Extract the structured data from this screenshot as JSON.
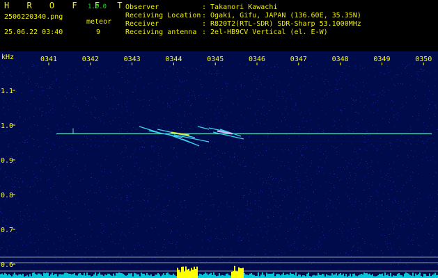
{
  "header": {
    "app_title": "H R O F F T",
    "app_version": "1.0.0",
    "filename": "2506220340.png",
    "datetime": "25.06.22 03:40",
    "meteor_label": "meteor",
    "meteor_count": "9"
  },
  "info": [
    {
      "label": "Observer",
      "value": ": Takanori Kawachi"
    },
    {
      "label": "Receiving Location",
      "value": ": Ogaki, Gifu, JAPAN (136.60E, 35.35N)"
    },
    {
      "label": "Receiver",
      "value": ": R820T2(RTL-SDR) SDR-Sharp 53.1000MHz"
    },
    {
      "label": "Receiving antenna",
      "value": ": 2el-HB9CV Vertical (el. E-W)"
    }
  ],
  "spectrogram": {
    "unit_label": "kHz",
    "time_labels": [
      "0341",
      "0342",
      "0343",
      "0344",
      "0345",
      "0346",
      "0347",
      "0348",
      "0349",
      "0350"
    ],
    "freq_labels": [
      "1.1",
      "1.0",
      "0.9",
      "0.8",
      "0.7",
      "0.6"
    ],
    "beacon_freq_khz": 0.975,
    "colors": {
      "background": "#000b4c",
      "noise": "#1a2aa0",
      "beacon": "#5fd6c0",
      "meteor": "#3ed0f0",
      "meteor_hot": "#e8b0ff",
      "histogram": "#00c8d8",
      "histogram_peak": "#ffff00",
      "axis_text": "#ffff00",
      "guide_line": "#c8c8c8"
    }
  }
}
